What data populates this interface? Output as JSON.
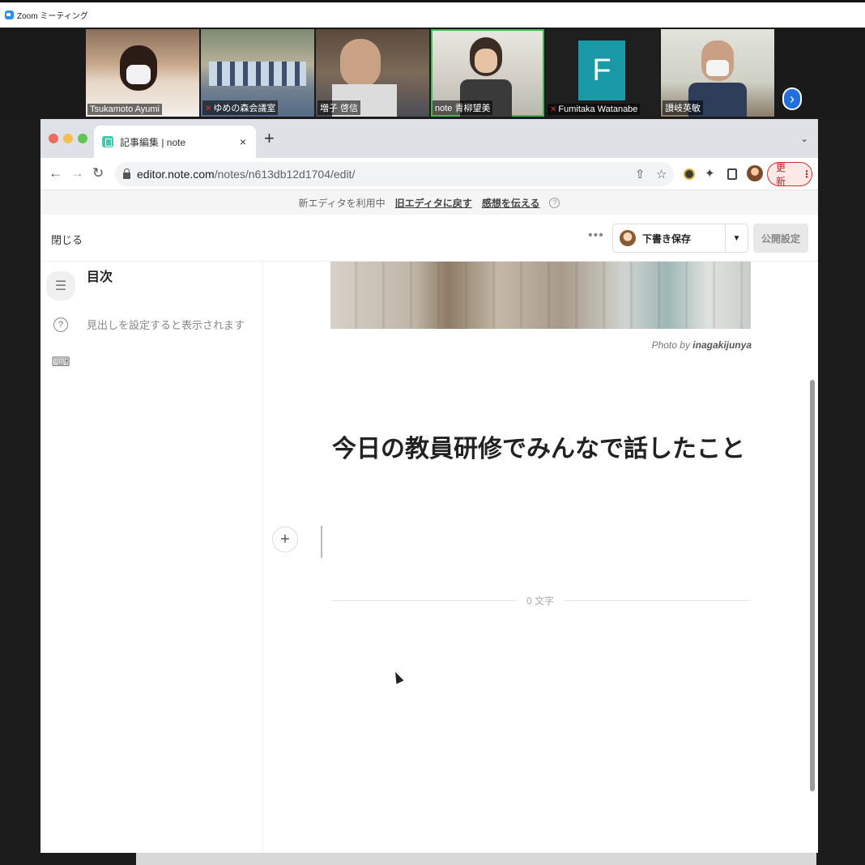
{
  "zoom": {
    "title": "Zoom ミーティング",
    "participants": [
      {
        "name": "Tsukamoto Ayumi",
        "muted": false
      },
      {
        "name": "ゆめの森会議室",
        "muted": true
      },
      {
        "name": "増子 啓信",
        "muted": false
      },
      {
        "name": "note 青柳望美",
        "muted": false,
        "active": true
      },
      {
        "name": "Fumitaka Watanabe",
        "muted": true,
        "initial": "F"
      },
      {
        "name": "讃岐英敏",
        "muted": false
      }
    ],
    "next_icon": "›"
  },
  "browser": {
    "tab_title": "記事編集 | note",
    "tab_close": "×",
    "new_tab": "+",
    "url_host": "editor.note.com",
    "url_path": "/notes/n613db12d1704/edit/",
    "update_label": "更新",
    "colors": {
      "update_border": "#d93025",
      "favicon": "#41c9b4"
    }
  },
  "editor": {
    "info_text": "新エディタを利用中",
    "old_editor_link": "旧エディタに戻す",
    "feedback_link": "感想を伝える",
    "close_label": "閉じる",
    "more_label": "•••",
    "draft_label": "下書き保存",
    "publish_label": "公開設定",
    "toc_title": "目次",
    "toc_empty": "見出しを設定すると表示されます",
    "photo_credit_prefix": "Photo by",
    "photo_credit_name": "inagakijunya",
    "article_title": "今日の教員研修でみんなで話したこと",
    "char_count": "0 文字",
    "plus": "+"
  }
}
